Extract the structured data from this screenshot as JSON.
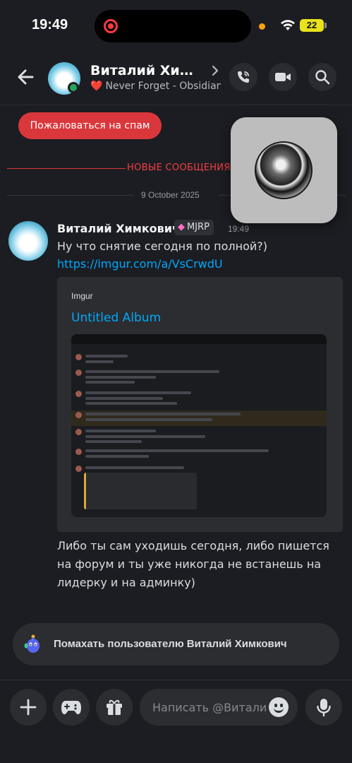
{
  "status_bar": {
    "time": "19:49",
    "battery": "22",
    "colors": {
      "battery": "#e8e31b",
      "recording": "#ff3b3b",
      "mic_indicator": "#ff9f0a"
    }
  },
  "header": {
    "back_icon": "arrow-left-icon",
    "name": "Виталий Химкович",
    "status_emoji": "❤️",
    "status_text": "Never Forget - Obsidian Sons",
    "actions": [
      "call-icon",
      "video-icon",
      "search-icon"
    ]
  },
  "spam_button": {
    "label": "Пожаловаться на спам",
    "color": "#da373c"
  },
  "new_messages_label": "НОВЫЕ СООБЩЕНИЯ",
  "date_separator": "9 October 2025",
  "message": {
    "author": "Виталий Химкович",
    "tag": "MJRP",
    "tag_icon": "gem-icon",
    "time": "19:49",
    "text": "Ну что снятие сегодня по полной?)",
    "link": "https://imgur.com/a/VsCrwdU",
    "embed": {
      "provider": "Imgur",
      "title": "Untitled Album"
    },
    "followup_text": "Либо ты сам уходишь сегодня, либо пишется на форум и ты уже никогда не встанешь на лидерку и на админку)"
  },
  "wave": {
    "icon": "wumpus-wave-icon",
    "label": "Помахать пользователю Виталий Химкович"
  },
  "composer": {
    "placeholder": "Написать @Виталий Химкович",
    "buttons": [
      "plus-icon",
      "gamepad-icon",
      "gift-icon"
    ],
    "emoji_icon": "emoji-icon",
    "mic_icon": "microphone-icon"
  },
  "colors": {
    "background": "#1c1d22",
    "link": "#00a8fc",
    "new_messages": "#f23f43",
    "online": "#23a55a"
  }
}
